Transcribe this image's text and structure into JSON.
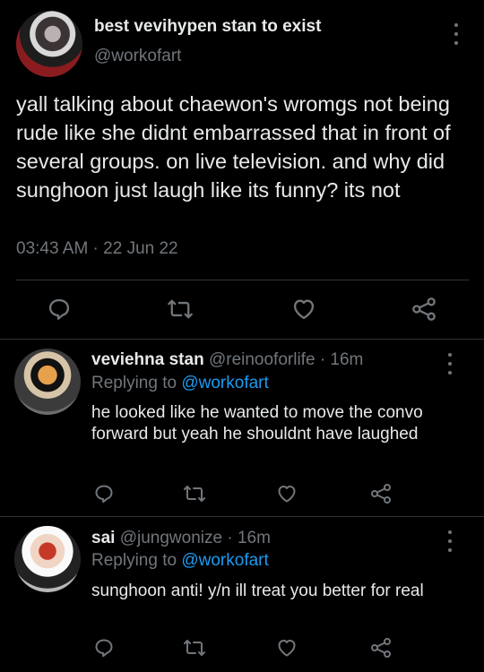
{
  "main_tweet": {
    "display_name": "best vevihypen stan to exist",
    "handle": "@workofart",
    "text": "yall talking about chaewon's wromgs not being rude like she didnt embarrassed that in front of several groups. on live television. and why did sunghoon just laugh like its funny? its not",
    "timestamp": "03:43 AM · 22 Jun 22"
  },
  "replies": [
    {
      "display_name": "veviehna stan",
      "handle": "@reinooforlife",
      "time": "· 16m",
      "replying_prefix": "Replying to ",
      "replying_to": "@workofart",
      "text": "he looked like he wanted to move the convo forward but yeah he shouldnt have laughed"
    },
    {
      "display_name": "sai",
      "handle": "@jungwonize",
      "time": "· 16m",
      "replying_prefix": "Replying to ",
      "replying_to": "@workofart",
      "text": "sunghoon anti! y/n ill treat you better for real"
    }
  ],
  "icons": [
    "reply-icon",
    "retweet-icon",
    "like-icon",
    "share-icon",
    "more-icon"
  ],
  "colors": {
    "background": "#000000",
    "text": "#e7e9ea",
    "muted": "#71767b",
    "link": "#1d9bf0",
    "divider": "#2f3336"
  }
}
